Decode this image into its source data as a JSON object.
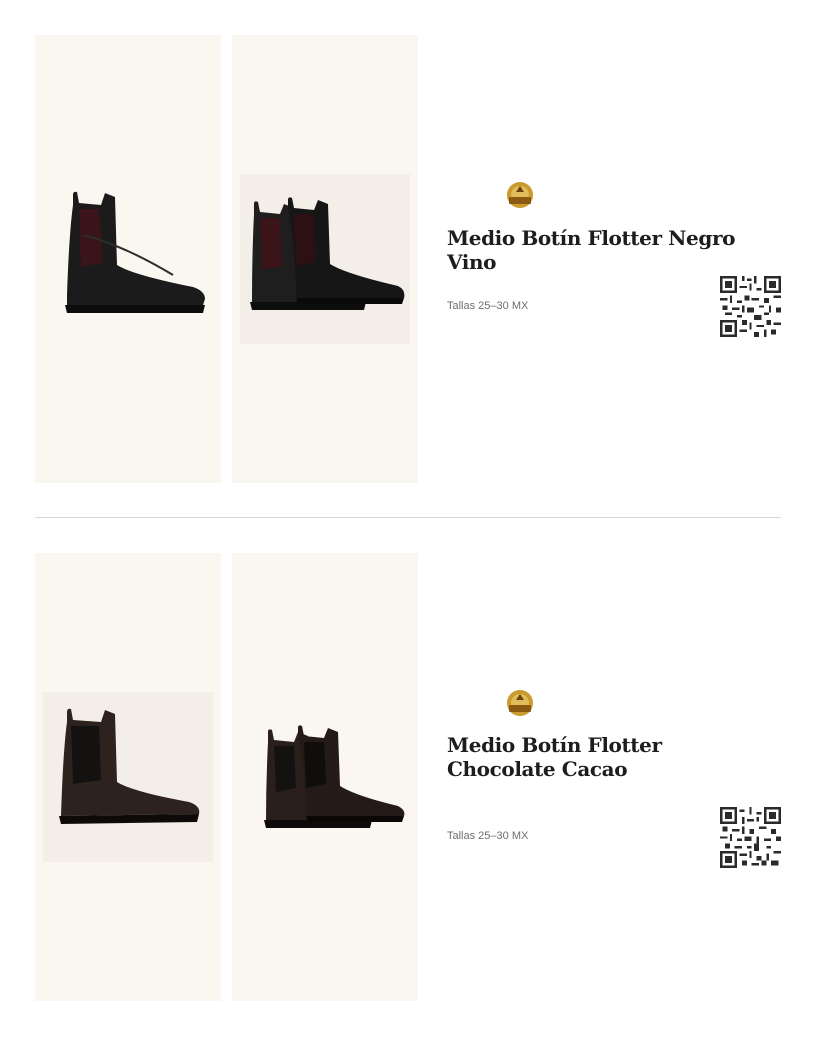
{
  "products": [
    {
      "name": "Medio Botín Flotter Negro Vino",
      "sizes": "Tallas 25–30 MX",
      "colors": {
        "leather": "#1a1a1a",
        "elastic": "#3a1418",
        "photo_bg": "#f3eee7"
      }
    },
    {
      "name": "Medio Botín Flotter Chocolate Cacao",
      "sizes": "Tallas 25–30 MX",
      "colors": {
        "leather": "#2e221e",
        "elastic": "#141111",
        "photo_bg": "#f3eee7"
      }
    }
  ],
  "colors": {
    "panel_bg": "#faf7f0",
    "title_text": "#1d1d1d",
    "sizes_text": "#6e6e6e",
    "divider": "#d8d8d8",
    "logo_gold": "#c99a2e"
  }
}
